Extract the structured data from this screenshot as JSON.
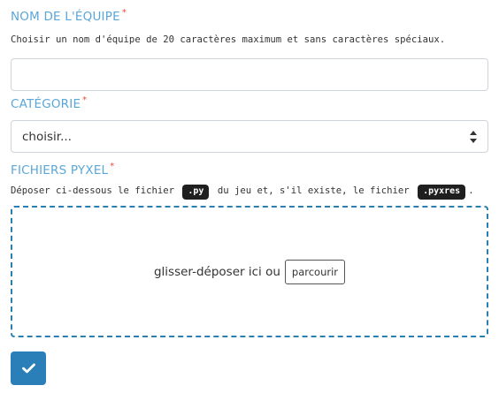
{
  "team_name": {
    "label": "NOM DE L'ÉQUIPE",
    "required_mark": "*",
    "help": "Choisir un nom d'équipe de 20 caractères maximum et sans caractères spéciaux.",
    "value": "",
    "placeholder": ""
  },
  "category": {
    "label": "CATÉGORIE",
    "required_mark": "*",
    "selected": "choisir..."
  },
  "files": {
    "label": "FICHIERS PYXEL",
    "required_mark": "*",
    "help_part1": "Déposer ci-dessous le fichier",
    "code_py": ".py",
    "help_part2": "du jeu et, s'il existe, le fichier",
    "code_pyxres": ".pyxres",
    "help_part3": ".",
    "drop_text": "glisser-déposer ici ou",
    "browse_label": "parcourir"
  },
  "submit": {
    "icon": "check-icon"
  },
  "colors": {
    "label": "#5aa6d8",
    "required": "#e74c3c",
    "dropzone_border": "#2b7fb0",
    "submit_bg": "#2b7fb8"
  }
}
